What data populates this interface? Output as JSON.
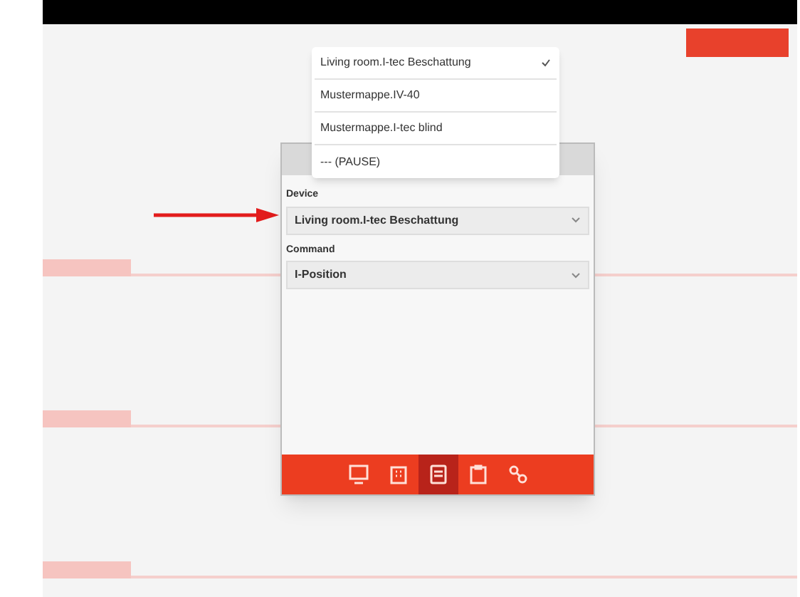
{
  "popover": {
    "items": [
      {
        "label": "Living room.I-tec Beschattung",
        "selected": true
      },
      {
        "label": "Mustermappe.IV-40",
        "selected": false
      },
      {
        "label": "Mustermappe.I-tec blind",
        "selected": false
      },
      {
        "label": "--- (PAUSE)",
        "selected": false
      }
    ]
  },
  "dialog": {
    "fields": [
      {
        "label": "Device",
        "value": "Living room.I-tec Beschattung"
      },
      {
        "label": "Command",
        "value": "I-Position"
      }
    ],
    "tab_bar": {
      "items": [
        {
          "kind": "screen",
          "selected": false
        },
        {
          "kind": "building",
          "selected": false
        },
        {
          "kind": "device",
          "selected": true
        },
        {
          "kind": "clipboard",
          "selected": false
        },
        {
          "kind": "nodes",
          "selected": false
        }
      ]
    }
  }
}
